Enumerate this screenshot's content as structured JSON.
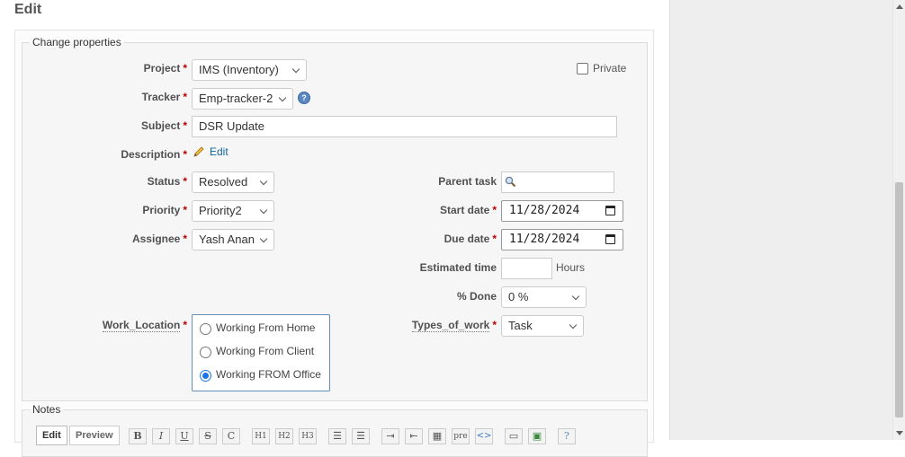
{
  "page": {
    "title": "Edit"
  },
  "form": {
    "fieldset_legend": "Change properties",
    "project": {
      "label": "Project",
      "value": "IMS (Inventory)"
    },
    "private": {
      "label": "Private",
      "checked": false
    },
    "tracker": {
      "label": "Tracker",
      "value": "Emp-tracker-2"
    },
    "subject": {
      "label": "Subject",
      "value": "DSR Update"
    },
    "description": {
      "label": "Description",
      "edit_link": "Edit"
    },
    "status": {
      "label": "Status",
      "value": "Resolved"
    },
    "priority": {
      "label": "Priority",
      "value": "Priority2"
    },
    "assignee": {
      "label": "Assignee",
      "value": "Yash Anan"
    },
    "parent_task": {
      "label": "Parent task",
      "value": ""
    },
    "start_date": {
      "label": "Start date",
      "value": "11/28/2024"
    },
    "due_date": {
      "label": "Due date",
      "value": "11/28/2024"
    },
    "estimated_time": {
      "label": "Estimated time",
      "value": "",
      "unit": "Hours"
    },
    "done": {
      "label": "% Done",
      "value": "0 %"
    },
    "work_location": {
      "label": "Work_Location",
      "options": [
        "Working From Home",
        "Working From Client",
        "Working FROM Office"
      ],
      "selected": "Working FROM Office"
    },
    "types_of_work": {
      "label": "Types_of_work",
      "value": "Task"
    },
    "required_marker": "*"
  },
  "notes": {
    "legend": "Notes",
    "tabs": [
      "Edit",
      "Preview"
    ],
    "toolbar": [
      "B",
      "I",
      "U",
      "S",
      "C",
      "H1",
      "H2",
      "H3",
      "pre"
    ]
  },
  "colors": {
    "link": "#116699",
    "required": "#bb0000",
    "radio_selected": "#1a73e8"
  }
}
